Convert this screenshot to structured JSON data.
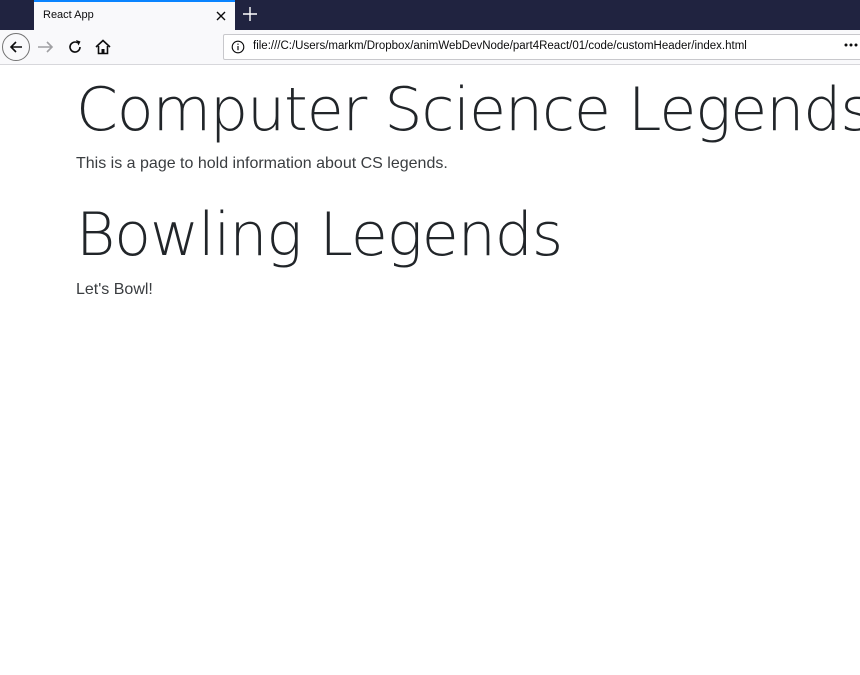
{
  "browser": {
    "tab_title": "React App",
    "url": "file:///C:/Users/markm/Dropbox/animWebDevNode/part4React/01/code/customHeader/index.html",
    "icons": {
      "tab_close": "close-icon",
      "new_tab": "plus-icon",
      "back": "arrow-left-icon",
      "forward": "arrow-right-icon",
      "reload": "reload-icon",
      "home": "home-icon",
      "site_info": "info-icon",
      "page_actions": "more-horizontal-icon"
    },
    "colors": {
      "tabstrip": "#202340",
      "tab_accent": "#0a84ff",
      "toolbar": "#f9f9fb"
    }
  },
  "page": {
    "sections": [
      {
        "heading": "Computer Science Legends",
        "lead": "This is a page to hold information about CS legends."
      },
      {
        "heading": "Bowling Legends",
        "lead": "Let's Bowl!"
      }
    ]
  }
}
